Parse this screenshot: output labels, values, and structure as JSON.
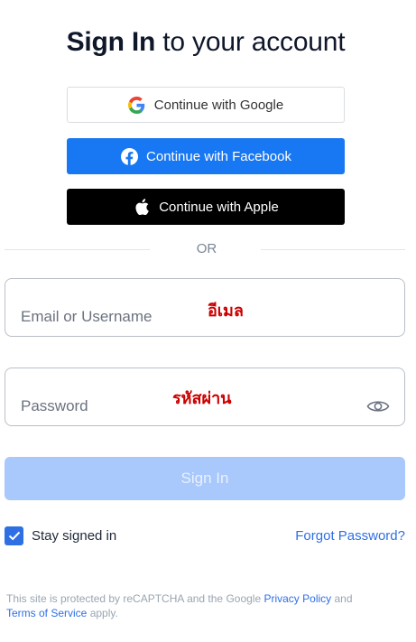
{
  "header": {
    "title_bold": "Sign In",
    "title_rest": " to your account"
  },
  "social": {
    "google_label": "Continue with Google",
    "facebook_label": "Continue with Facebook",
    "apple_label": "Continue with Apple"
  },
  "divider": {
    "text": "OR"
  },
  "email": {
    "placeholder": "Email or Username",
    "annotation": "อีเมล"
  },
  "password": {
    "placeholder": "Password",
    "annotation": "รหัสผ่าน"
  },
  "signin_label": "Sign In",
  "stay_signed_in": {
    "label": "Stay signed in",
    "checked": true
  },
  "forgot_label": "Forgot Password?",
  "legal": {
    "prefix": "This site is protected by reCAPTCHA and the Google ",
    "privacy_label": "Privacy Policy",
    "middle": " and",
    "terms_label": "Terms of Service",
    "suffix": " apply."
  },
  "colors": {
    "accent": "#2f6fe4",
    "facebook": "#1877f2",
    "apple": "#000000",
    "signin_disabled": "#a9c8fb",
    "annotation": "#cc0000"
  }
}
